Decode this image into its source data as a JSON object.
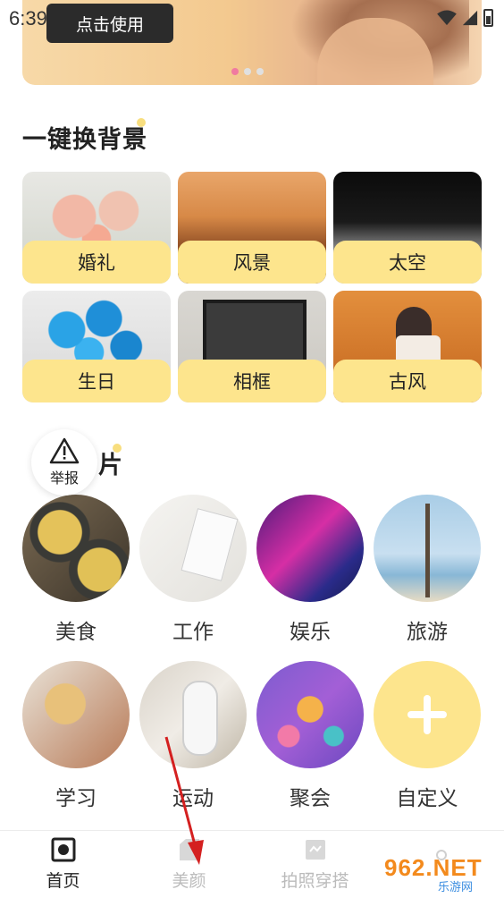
{
  "status_bar": {
    "time": "6:39"
  },
  "banner": {
    "use_button_label": "点击使用",
    "dots": 3,
    "active_dot": 0
  },
  "section_backgrounds": {
    "title": "一键换背景"
  },
  "backgrounds": [
    {
      "label": "婚礼"
    },
    {
      "label": "风景"
    },
    {
      "label": "太空"
    },
    {
      "label": "生日"
    },
    {
      "label": "相框"
    },
    {
      "label": "古风"
    }
  ],
  "section_photos": {
    "title_visible_part": "片"
  },
  "report_button": {
    "label": "举报"
  },
  "categories": [
    {
      "label": "美食"
    },
    {
      "label": "工作"
    },
    {
      "label": "娱乐"
    },
    {
      "label": "旅游"
    },
    {
      "label": "学习"
    },
    {
      "label": "运动"
    },
    {
      "label": "聚会"
    },
    {
      "label": "自定义"
    }
  ],
  "tabs": [
    {
      "label": "首页",
      "active": true
    },
    {
      "label": "美颜",
      "active": false
    },
    {
      "label": "拍照穿搭",
      "active": false
    }
  ],
  "watermark": {
    "main": "962.NET",
    "sub": "乐游网"
  },
  "colors": {
    "accent_yellow": "#fde58d",
    "dot_active": "#f07aa0",
    "arrow": "#d42020"
  }
}
